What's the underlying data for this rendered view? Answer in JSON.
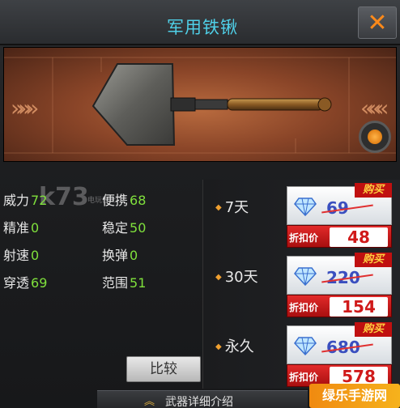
{
  "header": {
    "title": "军用铁锹",
    "close_glyph": "✕"
  },
  "watermark": {
    "text": "k73",
    "small": "电玩巴士"
  },
  "stats": [
    {
      "label": "威力",
      "value": "72"
    },
    {
      "label": "便携",
      "value": "68"
    },
    {
      "label": "精准",
      "value": "0"
    },
    {
      "label": "稳定",
      "value": "50"
    },
    {
      "label": "射速",
      "value": "0"
    },
    {
      "label": "换弹",
      "value": "0"
    },
    {
      "label": "穿透",
      "value": "69"
    },
    {
      "label": "范围",
      "value": "51"
    }
  ],
  "compare_label": "比较",
  "details_label": "武器详细介绍",
  "prices": [
    {
      "duration": "7天",
      "original": "69",
      "discount_label": "折扣价",
      "price": "48",
      "buy_tag": "购买"
    },
    {
      "duration": "30天",
      "original": "220",
      "discount_label": "折扣价",
      "price": "154",
      "buy_tag": "购买"
    },
    {
      "duration": "永久",
      "original": "680",
      "discount_label": "折扣价",
      "price": "578",
      "buy_tag": "购买"
    }
  ],
  "logo_text": "绿乐手游网",
  "colors": {
    "title": "#4fd0e8",
    "stat_value": "#7fe03c",
    "close": "#ff8a1a",
    "discount_bg": "#e22a2a"
  }
}
